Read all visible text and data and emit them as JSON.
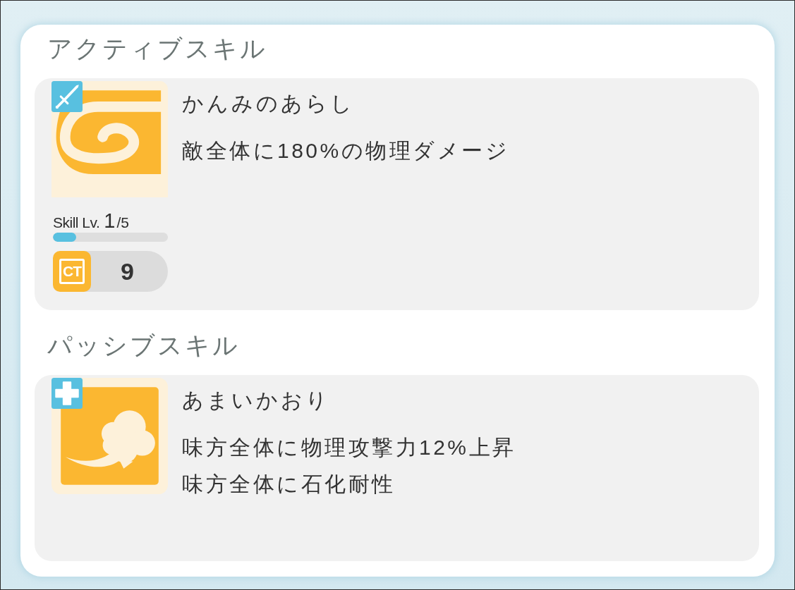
{
  "sections": [
    {
      "title": "アクティブスキル",
      "skills": [
        {
          "kind": "active",
          "name": "かんみのあらし",
          "effects": [
            "敵全体に180%の物理ダメージ"
          ],
          "level_label": "Skill Lv.",
          "level_value": "1",
          "level_max": "/5",
          "level": 0.2,
          "ct_label": "CT",
          "ct_value": "9"
        }
      ]
    },
    {
      "title": "パッシブスキル",
      "skills": [
        {
          "kind": "passive",
          "name": "あまいかおり",
          "effects": [
            "味方全体に物理攻撃力12%上昇",
            "味方全体に石化耐性"
          ]
        }
      ]
    }
  ]
}
